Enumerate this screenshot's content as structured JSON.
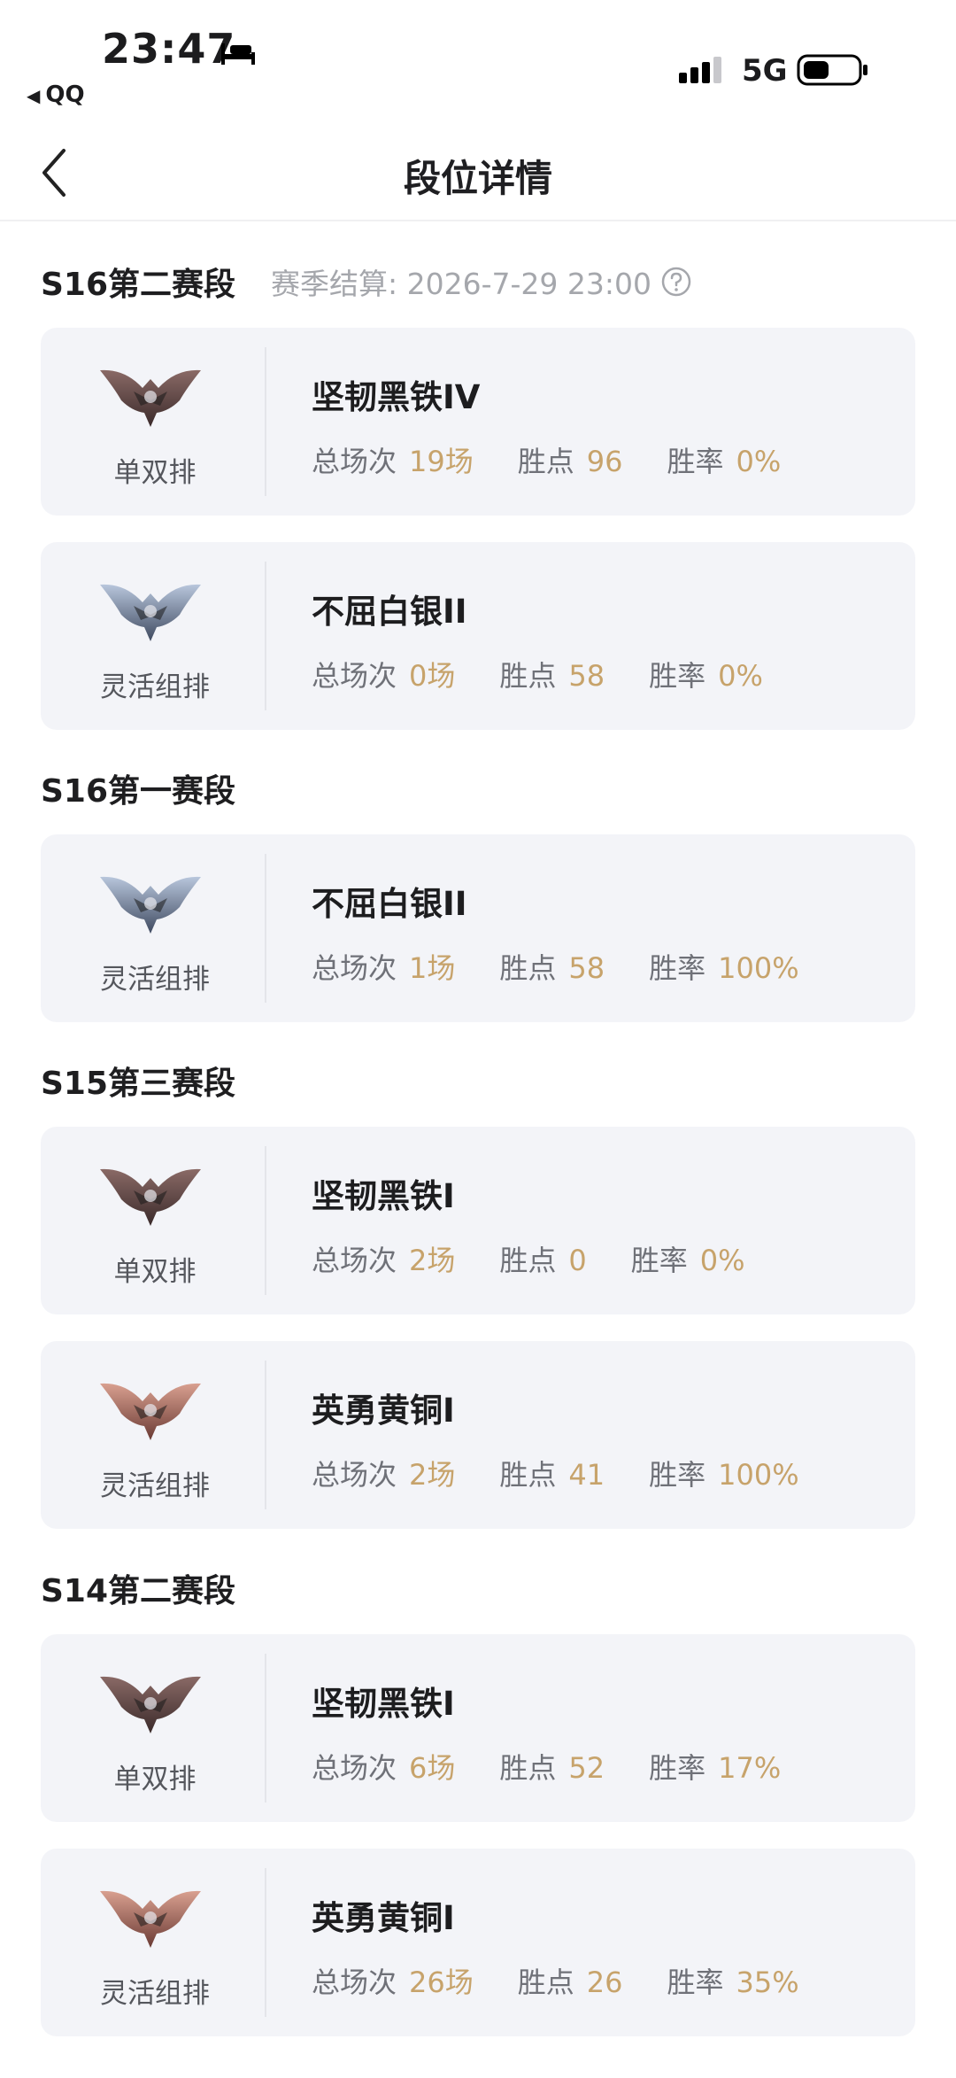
{
  "status_bar": {
    "time": "23:47",
    "back_app": "QQ",
    "network": "5G"
  },
  "nav": {
    "title": "段位详情"
  },
  "colors": {
    "accent_value": "#c7a36b",
    "card_bg": "#f3f4f8",
    "muted": "#a5a7ac"
  },
  "stat_labels": {
    "games": "总场次",
    "lp": "胜点",
    "winrate": "胜率"
  },
  "sections": [
    {
      "title": "S16第二赛段",
      "settle": "赛季结算: 2026-7-29 23:00",
      "cards": [
        {
          "queue": "单双排",
          "rank": "坚韧黑铁IV",
          "games": "19场",
          "lp": "96",
          "winrate": "0%",
          "emblem": "iron-emblem-icon"
        },
        {
          "queue": "灵活组排",
          "rank": "不屈白银II",
          "games": "0场",
          "lp": "58",
          "winrate": "0%",
          "emblem": "silver-emblem-icon"
        }
      ]
    },
    {
      "title": "S16第一赛段",
      "cards": [
        {
          "queue": "灵活组排",
          "rank": "不屈白银II",
          "games": "1场",
          "lp": "58",
          "winrate": "100%",
          "emblem": "silver-emblem-icon"
        }
      ]
    },
    {
      "title": "S15第三赛段",
      "cards": [
        {
          "queue": "单双排",
          "rank": "坚韧黑铁I",
          "games": "2场",
          "lp": "0",
          "winrate": "0%",
          "emblem": "iron-emblem-icon"
        },
        {
          "queue": "灵活组排",
          "rank": "英勇黄铜I",
          "games": "2场",
          "lp": "41",
          "winrate": "100%",
          "emblem": "bronze-emblem-icon"
        }
      ]
    },
    {
      "title": "S14第二赛段",
      "cards": [
        {
          "queue": "单双排",
          "rank": "坚韧黑铁I",
          "games": "6场",
          "lp": "52",
          "winrate": "17%",
          "emblem": "iron-emblem-icon"
        },
        {
          "queue": "灵活组排",
          "rank": "英勇黄铜I",
          "games": "26场",
          "lp": "26",
          "winrate": "35%",
          "emblem": "bronze-emblem-icon"
        }
      ]
    }
  ]
}
